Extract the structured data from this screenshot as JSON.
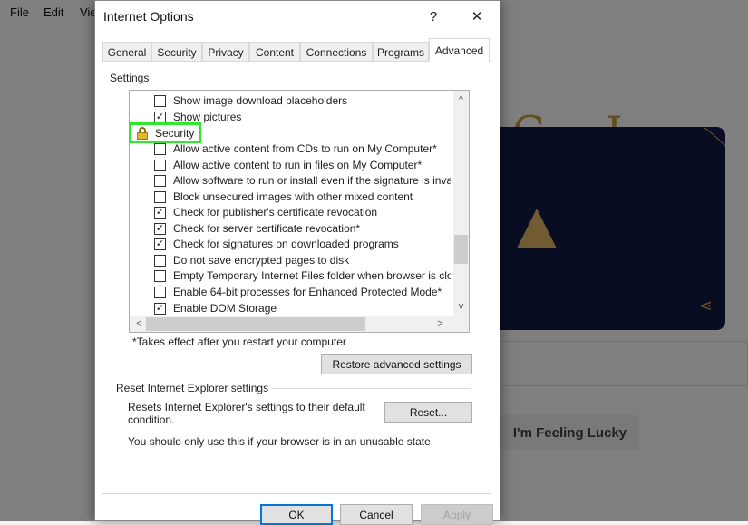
{
  "browser": {
    "menu": [
      "File",
      "Edit",
      "Vie"
    ],
    "doodle_letters": "G L E",
    "lucky_button": "I'm Feeling Lucky"
  },
  "dialog": {
    "title": "Internet Options",
    "help_label": "?",
    "close_label": "✕",
    "tabs": [
      "General",
      "Security",
      "Privacy",
      "Content",
      "Connections",
      "Programs",
      "Advanced"
    ],
    "active_tab": "Advanced",
    "settings_legend": "Settings",
    "tooltip": "Security",
    "items": [
      {
        "label": "Show image download placeholders",
        "checked": false
      },
      {
        "label": "Show pictures",
        "checked": true
      },
      {
        "label": "Security",
        "checked": null
      },
      {
        "label": "Allow active content from CDs to run on My Computer*",
        "checked": false
      },
      {
        "label": "Allow active content to run in files on My Computer*",
        "checked": false
      },
      {
        "label": "Allow software to run or install even if the signature is inva",
        "checked": false
      },
      {
        "label": "Block unsecured images with other mixed content",
        "checked": false
      },
      {
        "label": "Check for publisher's certificate revocation",
        "checked": true
      },
      {
        "label": "Check for server certificate revocation*",
        "checked": true
      },
      {
        "label": "Check for signatures on downloaded programs",
        "checked": true
      },
      {
        "label": "Do not save encrypted pages to disk",
        "checked": false
      },
      {
        "label": "Empty Temporary Internet Files folder when browser is clo",
        "checked": false
      },
      {
        "label": "Enable 64-bit processes for Enhanced Protected Mode*",
        "checked": false
      },
      {
        "label": "Enable DOM Storage",
        "checked": true
      }
    ],
    "restart_note": "*Takes effect after you restart your computer",
    "restore_button": "Restore advanced settings",
    "reset_section": "Reset Internet Explorer settings",
    "reset_description": "Resets Internet Explorer's settings to their default condition.",
    "reset_button": "Reset...",
    "reset_warning": "You should only use this if your browser is in an unusable state.",
    "ok_button": "OK",
    "cancel_button": "Cancel",
    "apply_button": "Apply"
  },
  "colors": {
    "highlight_border": "#2ee82e",
    "ok_border": "#0078d7"
  }
}
